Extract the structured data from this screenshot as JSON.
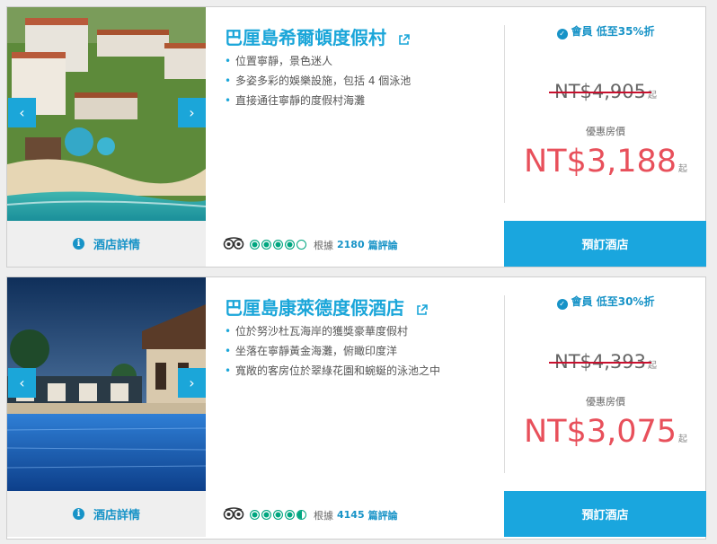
{
  "hotels": [
    {
      "name": "巴厘島希爾頓度假村",
      "features": [
        "位置寧靜，景色迷人",
        "多姿多彩的娛樂設施，包括 4 個泳池",
        "直接通往寧靜的度假村海灘"
      ],
      "details_label": "酒店詳情",
      "rating_bubbles": 4,
      "review_prefix": "根據",
      "review_count": "2180",
      "review_suffix": "篇評論",
      "member_discount": "會員 低至35%折",
      "original_price": "NT$4,905",
      "price_suffix": "起",
      "offer_label": "優惠房價",
      "price": "NT$3,188",
      "book_label": "預訂酒店"
    },
    {
      "name": "巴厘島康萊德度假酒店",
      "features": [
        "位於努沙杜瓦海岸的獲獎豪華度假村",
        "坐落在寧靜黃金海灘，俯瞰印度洋",
        "寬敞的客房位於翠綠花園和蜿蜒的泳池之中"
      ],
      "details_label": "酒店詳情",
      "rating_bubbles": 4.5,
      "review_prefix": "根據",
      "review_count": "4145",
      "review_suffix": "篇評論",
      "member_discount": "會員 低至30%折",
      "original_price": "NT$4,393",
      "price_suffix": "起",
      "offer_label": "優惠房價",
      "price": "NT$3,075",
      "book_label": "預訂酒店"
    }
  ],
  "colors": {
    "accent": "#1ba6d9",
    "price": "#e8505b",
    "strike": "#c8102e",
    "rating": "#00a680"
  },
  "icons": {
    "prev": "chevron-left-icon",
    "next": "chevron-right-icon",
    "external": "external-link-icon",
    "info": "info-icon",
    "check": "check-circle-icon",
    "tripadvisor": "tripadvisor-owl-icon"
  }
}
